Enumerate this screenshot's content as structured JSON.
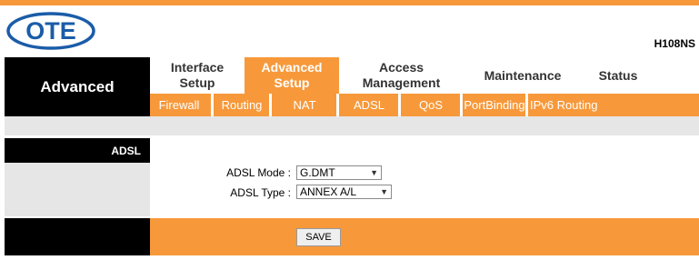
{
  "header": {
    "logo_text": "OTE",
    "model": "H108NS"
  },
  "colors": {
    "accent": "#f7993b",
    "logo_blue": "#1a5ca8",
    "panel_black": "#000000",
    "band_grey": "#e6e6e6"
  },
  "sidebar": {
    "title": "Advanced"
  },
  "tabs": [
    {
      "line1": "Interface",
      "line2": "Setup",
      "active": false
    },
    {
      "line1": "Advanced",
      "line2": "Setup",
      "active": true
    },
    {
      "line1": "Access",
      "line2": "Management",
      "active": false
    },
    {
      "line1": "Maintenance",
      "line2": "",
      "active": false
    },
    {
      "line1": "Status",
      "line2": "",
      "active": false
    }
  ],
  "subtabs": [
    "Firewall",
    "Routing",
    "NAT",
    "ADSL",
    "QoS",
    "PortBinding",
    "IPv6 Routing"
  ],
  "section": {
    "title": "ADSL",
    "fields": [
      {
        "label": "ADSL Mode :",
        "value": "G.DMT",
        "icon": "chevron-down-icon"
      },
      {
        "label": "ADSL Type :",
        "value": "ANNEX A/L",
        "icon": "chevron-down-icon"
      }
    ]
  },
  "footer": {
    "save_label": "SAVE"
  }
}
